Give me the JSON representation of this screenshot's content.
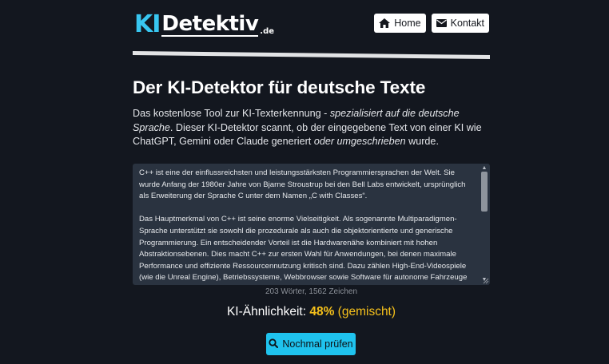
{
  "logo": {
    "ki": "KI",
    "name": "Detektiv",
    "tld": ".de"
  },
  "nav": {
    "home": {
      "label": "Home",
      "icon": "home-icon"
    },
    "contact": {
      "label": "Kontakt",
      "icon": "envelope-icon"
    }
  },
  "main": {
    "title": "Der KI-Detektor für deutsche Texte",
    "intro": {
      "part1": "Das kostenlose Tool zur KI-Texterkennung - ",
      "emph1": "spezialisiert auf die deutsche Sprache",
      "part2": ". Dieser KI-Detektor scannt, ob der eingegebene Text von einer KI wie ChatGPT, Gemini oder Claude generiert ",
      "emph2": "oder umgeschrieben",
      "part3": " wurde."
    },
    "input_text": {
      "paragraph1": "C++ ist eine der einflussreichsten und leistungsstärksten Programmiersprachen der Welt. Sie wurde Anfang der 1980er Jahre von Bjarne Stroustrup bei den Bell Labs entwickelt, ursprünglich als Erweiterung der Sprache C unter dem Namen „C with Classes“.",
      "paragraph2": "Das Hauptmerkmal von C++ ist seine enorme Vielseitigkeit. Als sogenannte Multiparadigmen-Sprache unterstützt sie sowohl die prozedurale als auch die objektorientierte und generische Programmierung. Ein entscheidender Vorteil ist die Hardwarenähe kombiniert mit hohen Abstraktionsebenen. Dies macht C++ zur ersten Wahl für Anwendungen, bei denen maximale Performance und effiziente Ressourcennutzung kritisch sind. Dazu zählen High-End-Videospiele (wie die Unreal Engine), Betriebssysteme, Webbrowser sowie Software für autonome Fahrzeuge und"
    },
    "word_count": "203 Wörter, 1562 Zeichen",
    "result": {
      "label": "KI-Ähnlichkeit: ",
      "percent": "48%",
      "classification": " (gemischt)"
    },
    "recheck_button": {
      "label": "Nochmal prüfen",
      "icon": "search-icon"
    }
  },
  "colors": {
    "background": "#13171f",
    "accent": "#1fc3ee",
    "logo_accent": "#38c6f0",
    "result_highlight": "#f5c01b",
    "textarea_bg": "#2a3340"
  }
}
